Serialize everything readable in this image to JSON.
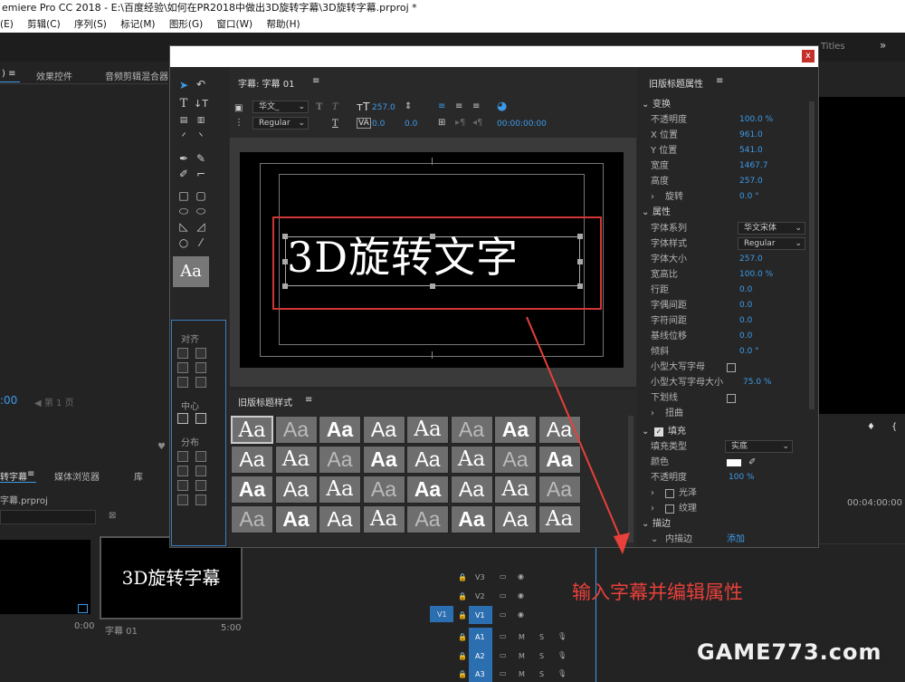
{
  "app": {
    "title": "emiere Pro CC 2018 - E:\\百度经验\\如何在PR2018中做出3D旋转字幕\\3D旋转字幕.prproj *",
    "menu": [
      "(E)",
      "剪辑(C)",
      "序列(S)",
      "标记(M)",
      "图形(G)",
      "窗口(W)",
      "帮助(H)"
    ],
    "workspace_tabs": [
      "Titles"
    ]
  },
  "left_panel": {
    "tabs": [
      "效果控件",
      "音频剪辑混合器"
    ],
    "timecode": ":00",
    "page_label": "第 1 页"
  },
  "project_panel": {
    "tabs": [
      "转字幕",
      "媒体浏览器",
      "库"
    ],
    "file": "字幕.prproj",
    "clips": [
      {
        "name": "",
        "duration": "0:00"
      },
      {
        "name": "字幕 01",
        "duration": "5:00",
        "preview_text": "3D旋转字幕"
      }
    ]
  },
  "dialog": {
    "close_label": "x",
    "title_panel": {
      "tab": "字幕: 字幕 01",
      "font_family": "华文_",
      "font_style": "Regular",
      "font_size": "257.0",
      "kerning": "0.0",
      "leading": "0.0",
      "timecode": "00:00:00:00"
    },
    "title_text": "3D旋转文字",
    "styles_panel": {
      "tab": "旧版标题样式",
      "swatch": "Aa",
      "swatch_count": 32
    },
    "tools": {
      "align_label": "对齐",
      "center_label": "中心",
      "distribute_label": "分布",
      "style_preview": "Aa"
    },
    "properties": {
      "tab": "旧版标题属性",
      "transform": {
        "section": "变换",
        "opacity_label": "不透明度",
        "opacity": "100.0 %",
        "x_label": "X 位置",
        "x": "961.0",
        "y_label": "Y 位置",
        "y": "541.0",
        "width_label": "宽度",
        "width": "1467.7",
        "height_label": "高度",
        "height": "257.0",
        "rotation_label": "旋转",
        "rotation": "0.0 °"
      },
      "attributes": {
        "section": "属性",
        "font_family_label": "字体系列",
        "font_family": "华文宋体",
        "font_style_label": "字体样式",
        "font_style": "Regular",
        "font_size_label": "字体大小",
        "font_size": "257.0",
        "aspect_label": "宽高比",
        "aspect": "100.0 %",
        "leading_label": "行距",
        "leading": "0.0",
        "kerning_label": "字偶间距",
        "kerning": "0.0",
        "tracking_label": "字符间距",
        "tracking": "0.0",
        "baseline_label": "基线位移",
        "baseline": "0.0",
        "slant_label": "倾斜",
        "slant": "0.0 °",
        "small_caps_label": "小型大写字母",
        "small_caps_size_label": "小型大写字母大小",
        "small_caps_size": "75.0 %",
        "underline_label": "下划线",
        "distort_label": "扭曲"
      },
      "fill": {
        "section": "填充",
        "fill_type_label": "填充类型",
        "fill_type": "实底",
        "color_label": "颜色",
        "color": "#ffffff",
        "opacity_label": "不透明度",
        "opacity": "100 %",
        "sheen_label": "光泽",
        "texture_label": "纹理"
      },
      "stroke": {
        "section": "描边",
        "inner_label": "内描边",
        "add_label": "添加"
      }
    }
  },
  "timeline": {
    "timecode": "00:04:00:00",
    "tracks": [
      "V3",
      "V2",
      "V1",
      "A1",
      "A2",
      "A3"
    ],
    "source_track": "V1",
    "mute_label": "M",
    "solo_label": "S"
  },
  "annotation": "输入字幕并编辑属性",
  "watermark": "GAME773.com",
  "colors": {
    "accent": "#3d9ae8",
    "highlight": "#d13636"
  }
}
